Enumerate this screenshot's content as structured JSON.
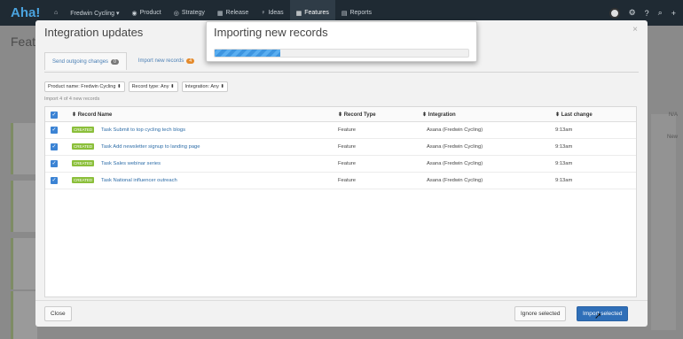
{
  "nav": {
    "logo": "Aha!",
    "items": [
      {
        "label": "⌂",
        "icon": "home-icon"
      },
      {
        "label": "Fredwin Cycling ▾"
      },
      {
        "label": "Product"
      },
      {
        "label": "Strategy"
      },
      {
        "label": "Release"
      },
      {
        "label": "Ideas"
      },
      {
        "label": "Features",
        "active": true
      },
      {
        "label": "Reports"
      }
    ]
  },
  "bg": {
    "title": "Featu",
    "na_label": "N/A",
    "new_label": "New"
  },
  "modal": {
    "title": "Integration updates",
    "close": "×",
    "tabs": [
      {
        "label": "Send outgoing changes",
        "count": "0"
      },
      {
        "label": "Import new records",
        "count": "4"
      }
    ],
    "filters": [
      "Product name: Fredwin Cycling ⬍",
      "Record type: Any ⬍",
      "Integration: Any ⬍"
    ],
    "import_count": "Import 4 of 4 new records",
    "columns": [
      "⬍ Record Name",
      "⬍ Record Type",
      "⬍ Integration",
      "⬍ Last change"
    ],
    "rows": [
      {
        "status": "CREATED",
        "name": "Task Submit to top cycling tech blogs",
        "type": "Feature",
        "integration": "Asana (Fredwin Cycling)",
        "changed": "9:13am"
      },
      {
        "status": "CREATED",
        "name": "Task Add newsletter signup to landing page",
        "type": "Feature",
        "integration": "Asana (Fredwin Cycling)",
        "changed": "9:13am"
      },
      {
        "status": "CREATED",
        "name": "Task Sales webinar series",
        "type": "Feature",
        "integration": "Asana (Fredwin Cycling)",
        "changed": "9:13am"
      },
      {
        "status": "CREATED",
        "name": "Task National influencer outreach",
        "type": "Feature",
        "integration": "Asana (Fredwin Cycling)",
        "changed": "9:13am"
      }
    ],
    "close_button": "Close",
    "ignore_button": "Ignore selected",
    "import_button": "Import selected"
  },
  "progress": {
    "title": "Importing new records",
    "value": 0.26,
    "color": "#3d95e0"
  },
  "colors": {
    "primary": "#2f6fb8",
    "created_badge": "#8bbf3a",
    "nav_bg": "#1f2a33"
  }
}
